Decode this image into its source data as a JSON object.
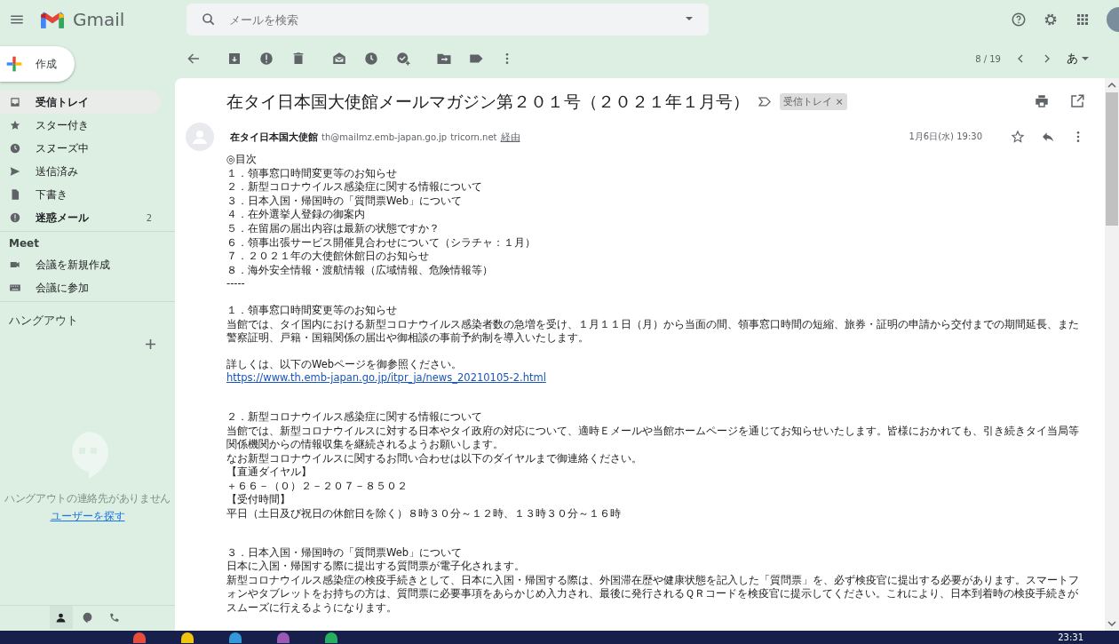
{
  "header": {
    "app_name": "Gmail",
    "search": {
      "placeholder": "メールを検索"
    }
  },
  "compose": {
    "label": "作成"
  },
  "nav": [
    {
      "label": "受信トレイ",
      "selected": true,
      "unread": true
    },
    {
      "label": "スター付き",
      "selected": false,
      "unread": false
    },
    {
      "label": "スヌーズ中",
      "selected": false,
      "unread": false
    },
    {
      "label": "送信済み",
      "selected": false,
      "unread": false
    },
    {
      "label": "下書き",
      "selected": false,
      "unread": false
    },
    {
      "label": "迷惑メール",
      "selected": false,
      "unread": true,
      "count": "2"
    }
  ],
  "meet": {
    "title": "Meet",
    "items": [
      {
        "label": "会議を新規作成"
      },
      {
        "label": "会議に参加"
      }
    ]
  },
  "hangouts": {
    "title": "ハングアウト",
    "empty_text": "ハングアウトの連絡先がありません",
    "link": "ユーザーを探す",
    "tabs": [
      {
        "selected": true
      },
      {
        "selected": false
      },
      {
        "selected": false
      }
    ]
  },
  "toolbar": {
    "pager": "8 / 19",
    "input_tool": "あ"
  },
  "email": {
    "subject": "在タイ日本国大使館メールマガジン第２０１号（２０２１年１月号）",
    "label_chip": "受信トレイ",
    "chip_close": "×",
    "sender_name": "在タイ日本国大使館",
    "sender_address": "th@mailmz.emb-japan.go.jp",
    "via_domain": "tricorn.net",
    "via_label": "経由",
    "date": "1月6日(水) 19:30",
    "starred": false,
    "body": [
      {
        "kind": "line",
        "text": "◎目次"
      },
      {
        "kind": "line",
        "text": "１．領事窓口時間変更等のお知らせ"
      },
      {
        "kind": "line",
        "text": "２．新型コロナウイルス感染症に関する情報について"
      },
      {
        "kind": "line",
        "text": "３．日本入国・帰国時の「質問票Web」について"
      },
      {
        "kind": "line",
        "text": "４．在外選挙人登録の御案内"
      },
      {
        "kind": "line",
        "text": "５．在留届の届出内容は最新の状態ですか？"
      },
      {
        "kind": "line",
        "text": "６．領事出張サービス開催見合わせについて（シラチャ：１月）"
      },
      {
        "kind": "line",
        "text": "７．２０２１年の大使館休館日のお知らせ"
      },
      {
        "kind": "line",
        "text": "８．海外安全情報・渡航情報（広域情報、危険情報等）"
      },
      {
        "kind": "line",
        "text": "-----"
      },
      {
        "kind": "gap"
      },
      {
        "kind": "line",
        "text": "１．領事窓口時間変更等のお知らせ"
      },
      {
        "kind": "line",
        "text": "当館では、タイ国内における新型コロナウイルス感染者数の急増を受け、１月１１日（月）から当面の間、領事窓口時間の短縮、旅券・証明の申請から交付までの期間延長、また警察証明、戸籍・国籍関係の届出や御相談の事前予約制を導入いたします。"
      },
      {
        "kind": "gap"
      },
      {
        "kind": "line",
        "text": "詳しくは、以下のWebページを御参照ください。"
      },
      {
        "kind": "link",
        "text": "https://www.th.emb-japan.go.jp/itpr_ja/news_20210105-2.html"
      },
      {
        "kind": "gap"
      },
      {
        "kind": "gap"
      },
      {
        "kind": "line",
        "text": "２．新型コロナウイルス感染症に関する情報について"
      },
      {
        "kind": "line",
        "text": "当館では、新型コロナウイルスに対する日本やタイ政府の対応について、適時Ｅメールや当館ホームページを通じてお知らせいたします。皆様におかれても、引き続きタイ当局等関係機関からの情報収集を継続されるようお願いします。"
      },
      {
        "kind": "line",
        "text": "なお新型コロナウイルスに関するお問い合わせは以下のダイヤルまで御連絡ください。"
      },
      {
        "kind": "line",
        "text": "【直通ダイヤル】"
      },
      {
        "kind": "line",
        "text": "＋６６－（０）２－２０７－８５０２"
      },
      {
        "kind": "line",
        "text": "【受付時間】"
      },
      {
        "kind": "line",
        "text": "平日（土日及び祝日の休館日を除く）８時３０分～１２時、１３時３０分～１６時"
      },
      {
        "kind": "gap"
      },
      {
        "kind": "gap"
      },
      {
        "kind": "line",
        "text": "３．日本入国・帰国時の「質問票Web」について"
      },
      {
        "kind": "line",
        "text": "日本に入国・帰国する際に提出する質問票が電子化されます。"
      },
      {
        "kind": "line",
        "text": "新型コロナウイルス感染症の検疫手続きとして、日本に入国・帰国する際は、外国滞在歴や健康状態を記入した「質問票」を、必ず検疫官に提出する必要があります。スマートフォンやタブレットをお持ちの方は、質問票に必要事項をあらかじめ入力され、最後に発行されるＱＲコードを検疫官に提示してください。これにより、日本到着時の検疫手続きがスムーズに行えるようになります。"
      }
    ]
  },
  "taskbar": {
    "time": "23:31"
  }
}
